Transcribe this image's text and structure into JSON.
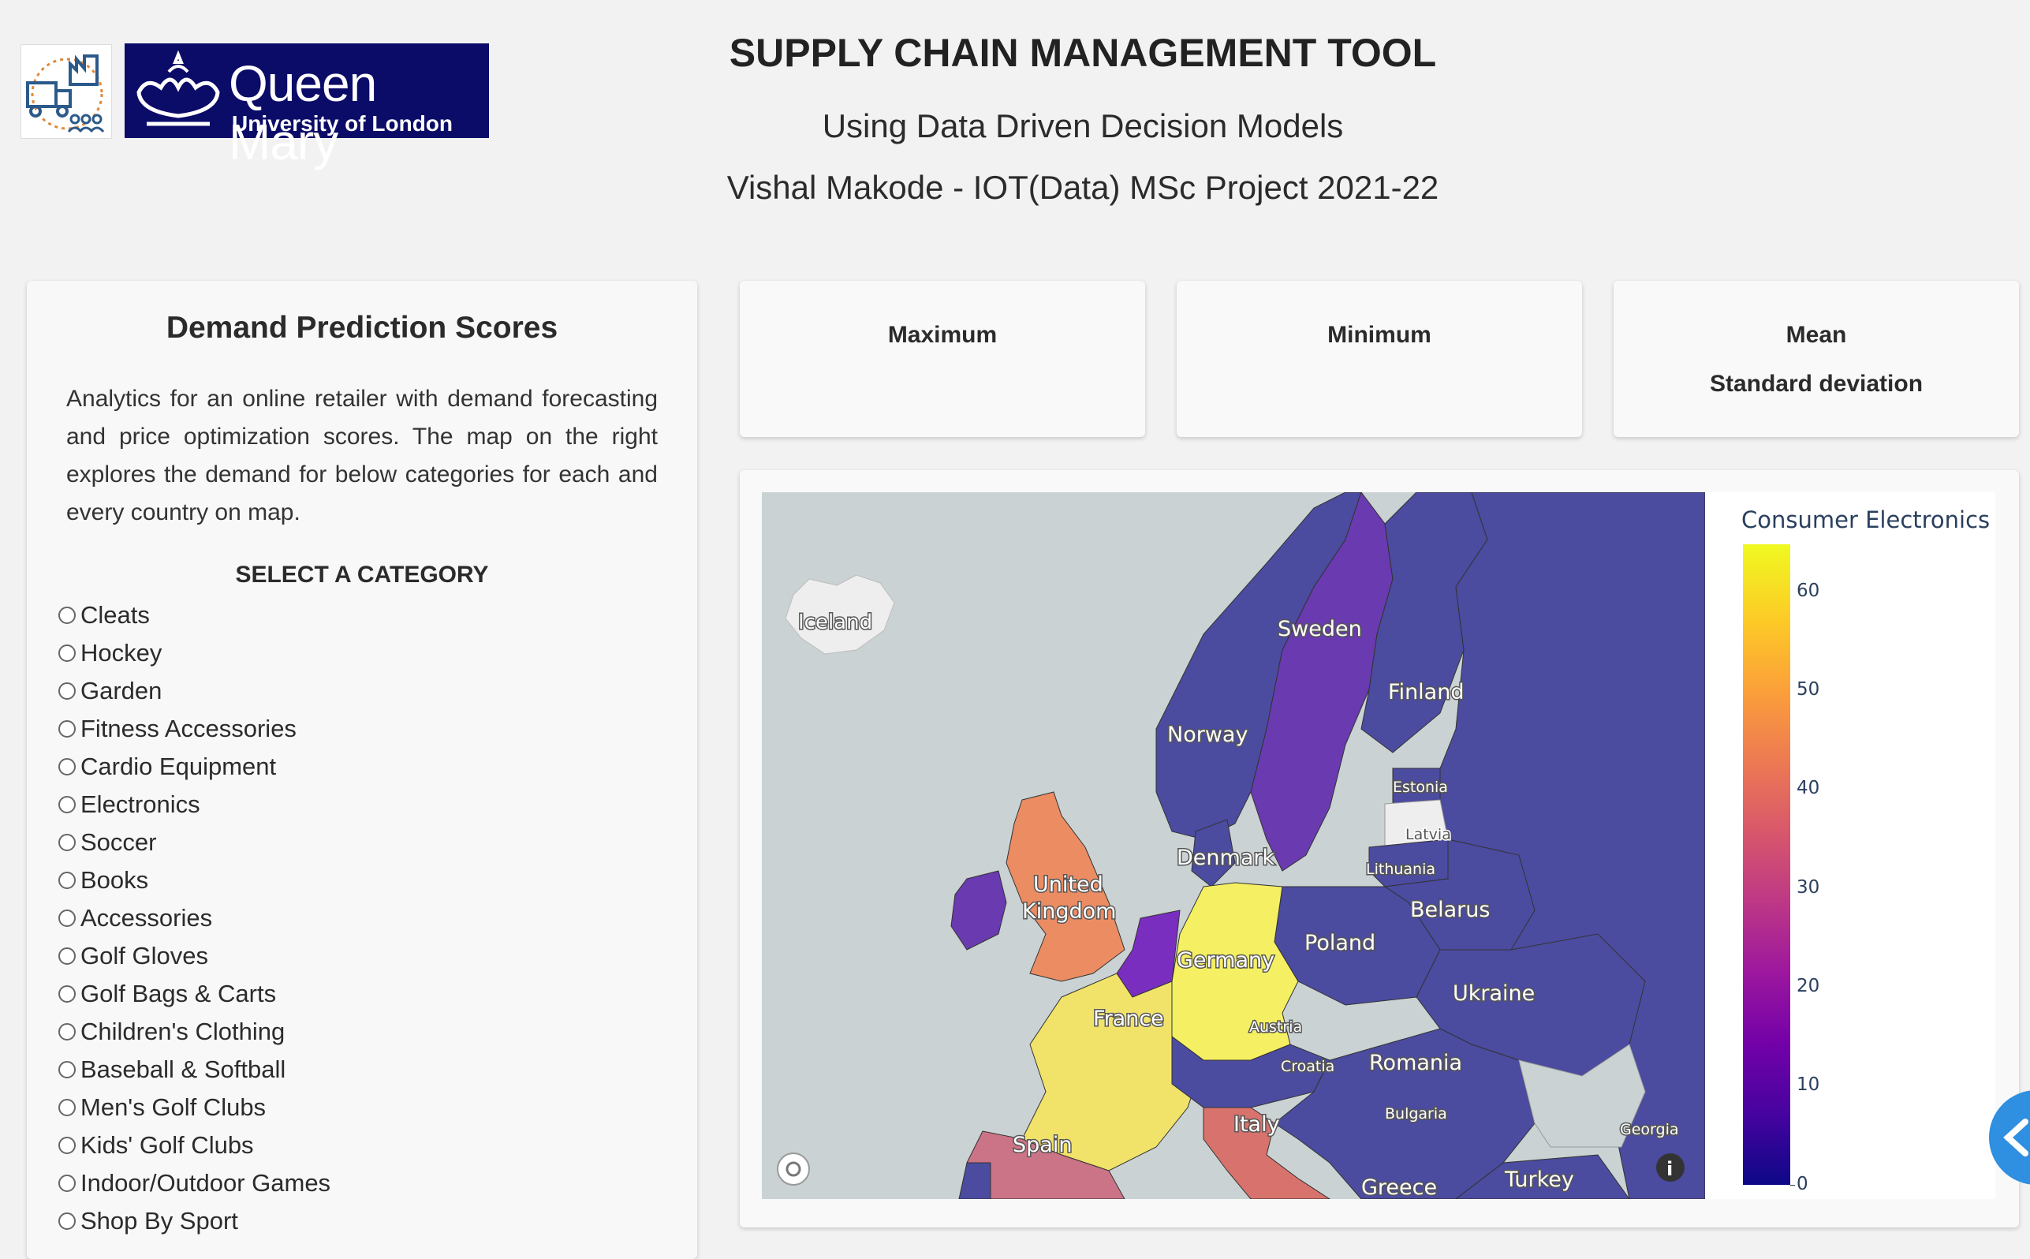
{
  "header": {
    "title": "SUPPLY CHAIN MANAGEMENT TOOL",
    "subtitle": "Using Data Driven Decision Models",
    "author_line": "Vishal Makode - IOT(Data) MSc Project 2021-22",
    "logo_name": "Queen Mary",
    "logo_sub": "University of London"
  },
  "left_panel": {
    "title": "Demand Prediction Scores",
    "description": "Analytics for an online retailer with demand forecasting and price optimization scores. The map on the right explores the demand for below categories for each and every country on map.",
    "category_heading": "SELECT A CATEGORY",
    "categories": [
      "Cleats",
      "Hockey",
      "Garden",
      "Fitness Accessories",
      "Cardio Equipment",
      "Electronics",
      "Soccer",
      "Books",
      "Accessories",
      "Golf Gloves",
      "Golf Bags & Carts",
      "Children's Clothing",
      "Baseball & Softball",
      "Men's Golf Clubs",
      "Kids' Golf Clubs",
      "Indoor/Outdoor Games",
      "Shop By Sport"
    ]
  },
  "stats": {
    "maximum_label": "Maximum",
    "minimum_label": "Minimum",
    "mean_label": "Mean",
    "std_label": "Standard deviation"
  },
  "map": {
    "colorbar_title": "Consumer Electronics",
    "colorbar_ticks": [
      "0",
      "10",
      "20",
      "30",
      "40",
      "50",
      "60"
    ],
    "colorscale": "plasma",
    "labels": {
      "iceland": "Iceland",
      "sweden": "Sweden",
      "finland": "Finland",
      "norway": "Norway",
      "estonia": "Estonia",
      "latvia": "Latvia",
      "lithuania": "Lithuania",
      "denmark": "Denmark",
      "uk1": "United",
      "uk2": "Kingdom",
      "belarus": "Belarus",
      "poland": "Poland",
      "germany": "Germany",
      "ukraine": "Ukraine",
      "france": "France",
      "austria": "Austria",
      "croatia": "Croatia",
      "romania": "Romania",
      "italy": "Italy",
      "bulgaria": "Bulgaria",
      "georgia": "Georgia",
      "spain": "Spain",
      "greece": "Greece",
      "turkey": "Turkey"
    },
    "colors": {
      "sea": "#cad2d3",
      "land": "#eeeeee",
      "low": "#4b4ba0",
      "purple": "#6a3ab0",
      "violet": "#7a2ec0",
      "orange": "#ec8c63",
      "salmon": "#d8726c",
      "pink": "#cc7487",
      "yellow": "#f5f063",
      "lightyellow": "#f1e36a"
    }
  }
}
